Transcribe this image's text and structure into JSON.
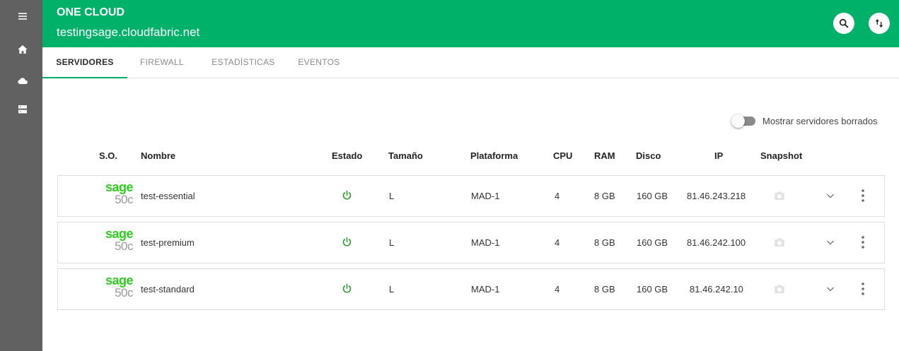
{
  "app": {
    "title": "ONE CLOUD",
    "subtitle": "testingsage.cloudfabric.net"
  },
  "colors": {
    "header": "#00b16a",
    "sidebar": "#616161",
    "status_on": "#2e9e2e",
    "logo_green": "#2ecc1f"
  },
  "sidebar": {
    "items": [
      {
        "icon": "menu-icon"
      },
      {
        "icon": "home-icon"
      },
      {
        "icon": "cloud-icon"
      },
      {
        "icon": "server-icon"
      }
    ]
  },
  "header_buttons": [
    {
      "icon": "search-icon"
    },
    {
      "icon": "sort-arrows-icon"
    }
  ],
  "tabs": [
    {
      "label": "SERVIDORES",
      "active": true
    },
    {
      "label": "FIREWALL",
      "active": false
    },
    {
      "label": "ESTADÍSTICAS",
      "active": false
    },
    {
      "label": "EVENTOS",
      "active": false
    }
  ],
  "toggle": {
    "label": "Mostrar servidores borrados",
    "checked": false
  },
  "table": {
    "columns": [
      "S.O.",
      "Nombre",
      "Estado",
      "Tamaño",
      "Plataforma",
      "CPU",
      "RAM",
      "Disco",
      "IP",
      "Snapshot"
    ],
    "logo": {
      "line1": "sage",
      "line2": "50c"
    },
    "rows": [
      {
        "name": "test-essential",
        "status": "power-on",
        "size": "L",
        "platform": "MAD-1",
        "cpu": "4",
        "ram": "8 GB",
        "disk": "160 GB",
        "ip": "81.46.243.218"
      },
      {
        "name": "test-premium",
        "status": "power-on",
        "size": "L",
        "platform": "MAD-1",
        "cpu": "4",
        "ram": "8 GB",
        "disk": "160 GB",
        "ip": "81.46.242.100"
      },
      {
        "name": "test-standard",
        "status": "power-on",
        "size": "L",
        "platform": "MAD-1",
        "cpu": "4",
        "ram": "8 GB",
        "disk": "160 GB",
        "ip": "81.46.242.10"
      }
    ]
  }
}
